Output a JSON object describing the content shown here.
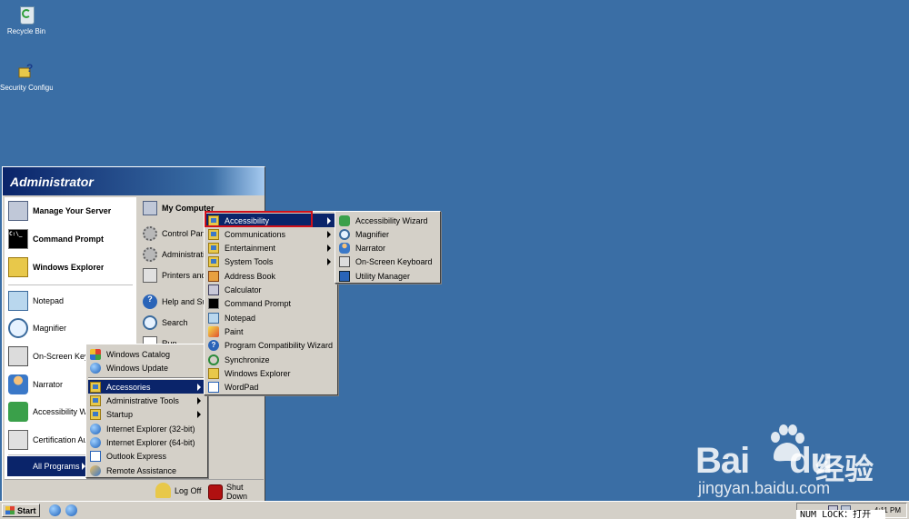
{
  "desktop": {
    "icons": [
      {
        "label": "Recycle Bin",
        "icon": "recycle-bin-icon"
      },
      {
        "label": "Security Configurati...",
        "icon": "security-config-icon"
      }
    ]
  },
  "start_menu": {
    "user": "Administrator",
    "left_pinned": [
      {
        "label": "Manage Your Server",
        "icon": "manage-server-icon"
      },
      {
        "label": "Command Prompt",
        "icon": "command-prompt-icon"
      },
      {
        "label": "Windows Explorer",
        "icon": "windows-explorer-icon"
      }
    ],
    "left_recent": [
      {
        "label": "Notepad",
        "icon": "notepad-icon"
      },
      {
        "label": "Magnifier",
        "icon": "magnifier-icon"
      },
      {
        "label": "On-Screen Keyb",
        "icon": "keyboard-icon"
      },
      {
        "label": "Narrator",
        "icon": "narrator-icon"
      },
      {
        "label": "Accessibility Wiz",
        "icon": "accessibility-icon"
      },
      {
        "label": "Certification Au",
        "icon": "certificate-icon"
      }
    ],
    "all_programs": "All Programs",
    "right_items": [
      {
        "label": "My Computer",
        "icon": "computer-icon"
      },
      {
        "label": "Control Pane",
        "icon": "control-panel-icon"
      },
      {
        "label": "Administrativ",
        "icon": "admin-tools-icon"
      },
      {
        "label": "Printers and F",
        "icon": "printer-icon"
      },
      {
        "label": "Help and Sup",
        "icon": "help-icon"
      },
      {
        "label": "Search",
        "icon": "search-icon"
      },
      {
        "label": "Run",
        "icon": "run-icon"
      }
    ],
    "log_off": "Log Off",
    "shut_down": "Shut Down"
  },
  "all_programs_menu": {
    "items": [
      {
        "label": "Windows Catalog",
        "icon": "catalog-icon",
        "submenu": false
      },
      {
        "label": "Windows Update",
        "icon": "globe-icon",
        "submenu": false
      },
      {
        "label": "Accessories",
        "icon": "folder-icon",
        "submenu": true,
        "selected": true
      },
      {
        "label": "Administrative Tools",
        "icon": "folder-icon",
        "submenu": true
      },
      {
        "label": "Startup",
        "icon": "folder-icon",
        "submenu": true
      },
      {
        "label": "Internet Explorer (32-bit)",
        "icon": "ie-icon",
        "submenu": false
      },
      {
        "label": "Internet Explorer (64-bit)",
        "icon": "ie-icon",
        "submenu": false
      },
      {
        "label": "Outlook Express",
        "icon": "mail-icon",
        "submenu": false
      },
      {
        "label": "Remote Assistance",
        "icon": "remote-assistance-icon",
        "submenu": false
      }
    ]
  },
  "accessories_menu": {
    "items": [
      {
        "label": "Accessibility",
        "icon": "folder-icon",
        "submenu": true,
        "selected": true
      },
      {
        "label": "Communications",
        "icon": "folder-icon",
        "submenu": true
      },
      {
        "label": "Entertainment",
        "icon": "folder-icon",
        "submenu": true
      },
      {
        "label": "System Tools",
        "icon": "folder-icon",
        "submenu": true
      },
      {
        "label": "Address Book",
        "icon": "address-book-icon",
        "submenu": false
      },
      {
        "label": "Calculator",
        "icon": "calculator-icon",
        "submenu": false
      },
      {
        "label": "Command Prompt",
        "icon": "command-prompt-icon",
        "submenu": false
      },
      {
        "label": "Notepad",
        "icon": "notepad-icon",
        "submenu": false
      },
      {
        "label": "Paint",
        "icon": "paint-icon",
        "submenu": false
      },
      {
        "label": "Program Compatibility Wizard",
        "icon": "compat-icon",
        "submenu": false
      },
      {
        "label": "Synchronize",
        "icon": "sync-icon",
        "submenu": false
      },
      {
        "label": "Windows Explorer",
        "icon": "windows-explorer-icon",
        "submenu": false
      },
      {
        "label": "WordPad",
        "icon": "wordpad-icon",
        "submenu": false
      }
    ]
  },
  "accessibility_menu": {
    "items": [
      {
        "label": "Accessibility Wizard",
        "icon": "accessibility-icon"
      },
      {
        "label": "Magnifier",
        "icon": "magnifier-icon"
      },
      {
        "label": "Narrator",
        "icon": "narrator-icon"
      },
      {
        "label": "On-Screen Keyboard",
        "icon": "keyboard-icon"
      },
      {
        "label": "Utility Manager",
        "icon": "utility-manager-icon"
      }
    ]
  },
  "taskbar": {
    "start_label": "Start",
    "clock": "4:11 PM",
    "numlock": "NUM LOCK：打开"
  },
  "watermark": {
    "brand": "Bai",
    "brand_suffix": "du",
    "cn": "经验",
    "url": "jingyan.baidu.com"
  },
  "colors": {
    "desktop": "#3a6ea5",
    "menu_highlight": "#0a246a",
    "annotation_box": "#d0101a"
  }
}
